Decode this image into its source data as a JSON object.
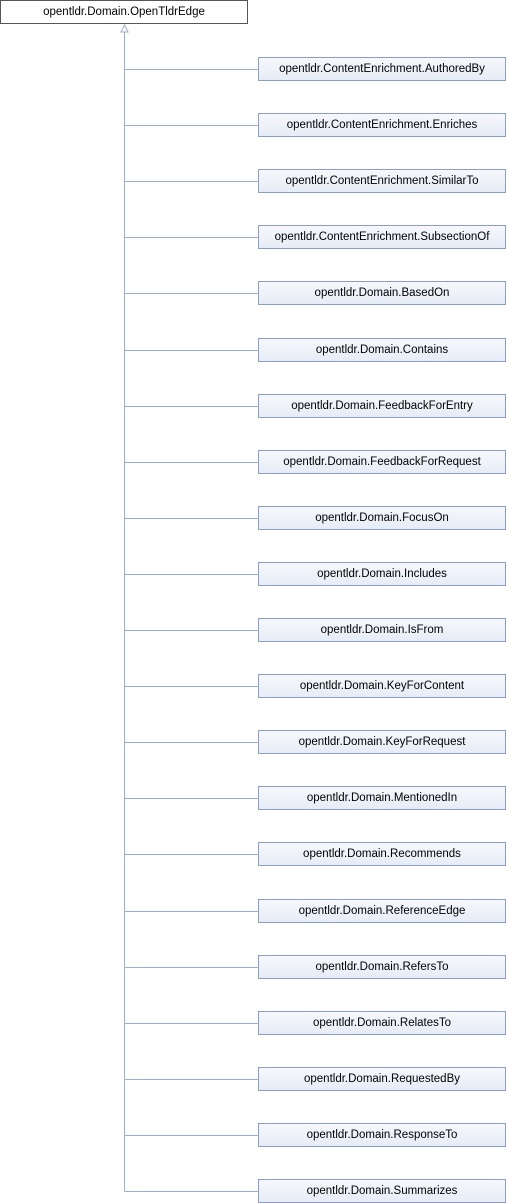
{
  "diagram": {
    "root": {
      "label": "opentldr.Domain.OpenTldrEdge"
    },
    "children": [
      {
        "label": "opentldr.ContentEnrichment.AuthoredBy"
      },
      {
        "label": "opentldr.ContentEnrichment.Enriches"
      },
      {
        "label": "opentldr.ContentEnrichment.SimilarTo"
      },
      {
        "label": "opentldr.ContentEnrichment.SubsectionOf"
      },
      {
        "label": "opentldr.Domain.BasedOn"
      },
      {
        "label": "opentldr.Domain.Contains"
      },
      {
        "label": "opentldr.Domain.FeedbackForEntry"
      },
      {
        "label": "opentldr.Domain.FeedbackForRequest"
      },
      {
        "label": "opentldr.Domain.FocusOn"
      },
      {
        "label": "opentldr.Domain.Includes"
      },
      {
        "label": "opentldr.Domain.IsFrom"
      },
      {
        "label": "opentldr.Domain.KeyForContent"
      },
      {
        "label": "opentldr.Domain.KeyForRequest"
      },
      {
        "label": "opentldr.Domain.MentionedIn"
      },
      {
        "label": "opentldr.Domain.Recommends"
      },
      {
        "label": "opentldr.Domain.ReferenceEdge"
      },
      {
        "label": "opentldr.Domain.RefersTo"
      },
      {
        "label": "opentldr.Domain.RelatesTo"
      },
      {
        "label": "opentldr.Domain.RequestedBy"
      },
      {
        "label": "opentldr.Domain.ResponseTo"
      },
      {
        "label": "opentldr.Domain.Summarizes"
      }
    ],
    "colors": {
      "connector": "#9ab0cf",
      "node_border": "#8b9ec7",
      "root_border": "#555555"
    }
  }
}
